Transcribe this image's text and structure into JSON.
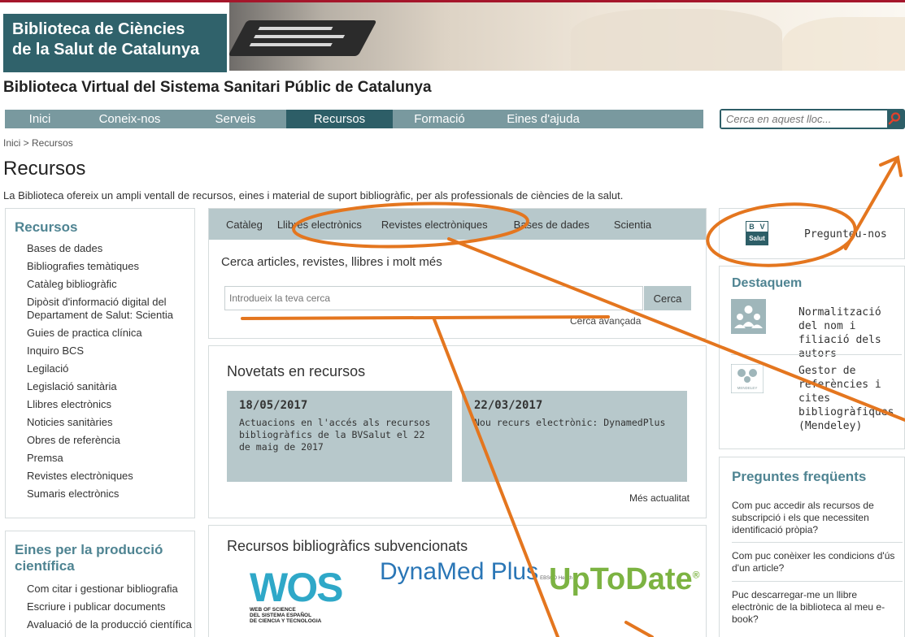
{
  "logo": {
    "line1": "Biblioteca de Ciències",
    "line2": "de la Salut de Catalunya"
  },
  "site_title": "Biblioteca Virtual del Sistema Sanitari Públic de Catalunya",
  "nav": [
    "Inici",
    "Coneix-nos",
    "Serveis",
    "Recursos",
    "Formació",
    "Eines d'ajuda"
  ],
  "nav_active": "Recursos",
  "top_search": {
    "placeholder": "Cerca en aquest lloc..."
  },
  "breadcrumb": "Inici > Recursos",
  "page_title": "Recursos",
  "intro": "La Biblioteca ofereix un ampli ventall de recursos, eines i material de suport bibliogràfic, per als professionals de ciències de la salut.",
  "sidebar_recursos": {
    "title": "Recursos",
    "items": [
      "Bases de dades",
      "Bibliografies temàtiques",
      "Catàleg bibliogràfic",
      "Dipòsit d'informació digital del Departament de Salut: Scientia",
      "Guies de practica clínica",
      "Inquiro BCS",
      "Legilació",
      "Legislació sanitària",
      "Llibres electrònics",
      "Noticies sanitàries",
      "Obres de referència",
      "Premsa",
      "Revistes electròniques",
      "Sumaris electrònics"
    ]
  },
  "sidebar_eines": {
    "title": "Eines per la producció científica",
    "items": [
      "Com citar i gestionar bibliografia",
      "Escriure i publicar documents",
      "Avaluació de la producció científica"
    ]
  },
  "search_tabs": [
    "Catàleg",
    "Llibres electrònics",
    "Revistes electròniques",
    "Bases de dades",
    "Scientia"
  ],
  "search": {
    "prompt": "Cerca articles, revistes, llibres i molt més",
    "placeholder": "Introdueix la teva cerca",
    "button": "Cerca",
    "advanced": "Cerca avançada"
  },
  "news": {
    "title": "Novetats en recursos",
    "items": [
      {
        "date": "18/05/2017",
        "text": "Actuacions en l'accés als recursos bibliogràfics de la BVSalut el 22 de maig de 2017"
      },
      {
        "date": "22/03/2017",
        "text": "Nou recurs electrònic: DynamedPlus"
      }
    ],
    "more": "Més actualitat"
  },
  "subv": {
    "title": "Recursos bibliogràfics subvencionats",
    "wos_big": "WOS",
    "wos_small": [
      "WEB OF SCIENCE",
      "DEL SISTEMA ESPAÑOL",
      "DE CIENCIA Y TECNOLOGIA"
    ],
    "dyna": "DynaMed Plus",
    "dyna_sub": "EBSCO Health",
    "utd": "UpToDate"
  },
  "ask": {
    "logo_b": "B",
    "logo_v": "V",
    "logo_salut": "Salut",
    "label": "Pregunteu-nos"
  },
  "destaquem": {
    "title": "Destaquem",
    "items": [
      {
        "text": "Normalització del nom i filiació dels autors",
        "icon_label": ""
      },
      {
        "text": "Gestor de referències i cites bibliogràfiques (Mendeley)",
        "icon_label": "MENDELEY"
      }
    ]
  },
  "faq": {
    "title": "Preguntes freqüents",
    "items": [
      "Com puc accedir als recursos de subscripció i els que necessiten identificació pròpia?",
      "Com puc conèixer les condicions d'ús d'un article?",
      "Puc descarregar-me un llibre electrònic de la biblioteca al meu e-book?"
    ]
  },
  "colors": {
    "nav": "#79999f",
    "nav_active": "#2d5e67",
    "accent_red": "#a5162b",
    "annotation": "#e4761f",
    "heading": "#4f8492"
  }
}
